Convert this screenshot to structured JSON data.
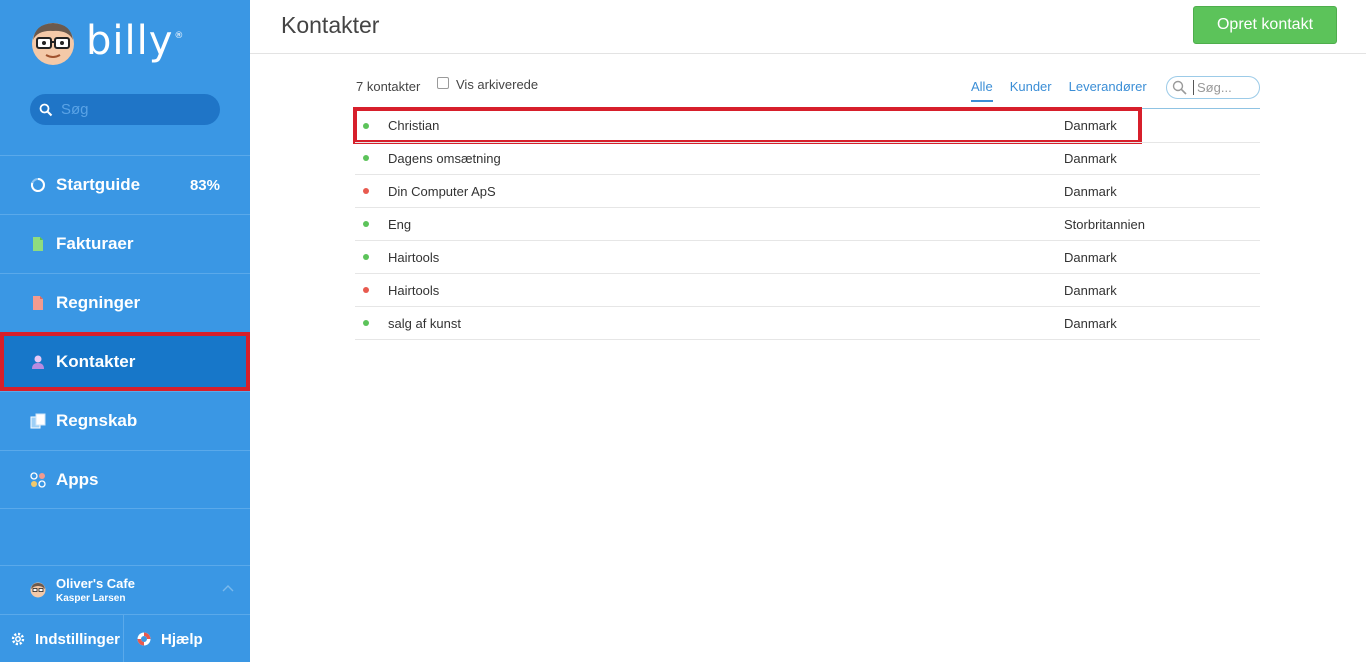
{
  "app": {
    "logo_text": "billy",
    "logo_mark": "®"
  },
  "sidebar": {
    "search_placeholder": "Søg",
    "items": [
      {
        "label": "Startguide",
        "icon": "progress-ring-icon",
        "badge": "83%"
      },
      {
        "label": "Fakturaer",
        "icon": "invoice-icon"
      },
      {
        "label": "Regninger",
        "icon": "bill-icon"
      },
      {
        "label": "Kontakter",
        "icon": "contact-icon",
        "active": true
      },
      {
        "label": "Regnskab",
        "icon": "accounting-icon"
      },
      {
        "label": "Apps",
        "icon": "apps-icon"
      }
    ],
    "organization": {
      "name": "Oliver's Cafe",
      "user": "Kasper Larsen"
    },
    "bottom": {
      "settings": "Indstillinger",
      "help": "Hjælp"
    }
  },
  "header": {
    "title": "Kontakter",
    "create_button": "Opret kontakt"
  },
  "toolbar": {
    "count": "7 kontakter",
    "archived_label": "Vis arkiverede",
    "filters": [
      "Alle",
      "Kunder",
      "Leverandører"
    ],
    "active_filter": "Alle",
    "search_placeholder": "Søg..."
  },
  "contacts": [
    {
      "name": "Christian",
      "country": "Danmark",
      "status_color": "#5cc35a"
    },
    {
      "name": "Dagens omsætning",
      "country": "Danmark",
      "status_color": "#5cc35a"
    },
    {
      "name": "Din Computer ApS",
      "country": "Danmark",
      "status_color": "#e85a4f"
    },
    {
      "name": "Eng",
      "country": "Storbritannien",
      "status_color": "#5cc35a"
    },
    {
      "name": "Hairtools",
      "country": "Danmark",
      "status_color": "#5cc35a"
    },
    {
      "name": "Hairtools",
      "country": "Danmark",
      "status_color": "#e85a4f"
    },
    {
      "name": "salg af kunst",
      "country": "Danmark",
      "status_color": "#5cc35a"
    }
  ],
  "colors": {
    "sidebar": "#3a97e4",
    "active_nav": "#1777c9",
    "primary_button": "#5cc35a",
    "highlight": "#d71f2b",
    "link": "#3b8ed6"
  }
}
